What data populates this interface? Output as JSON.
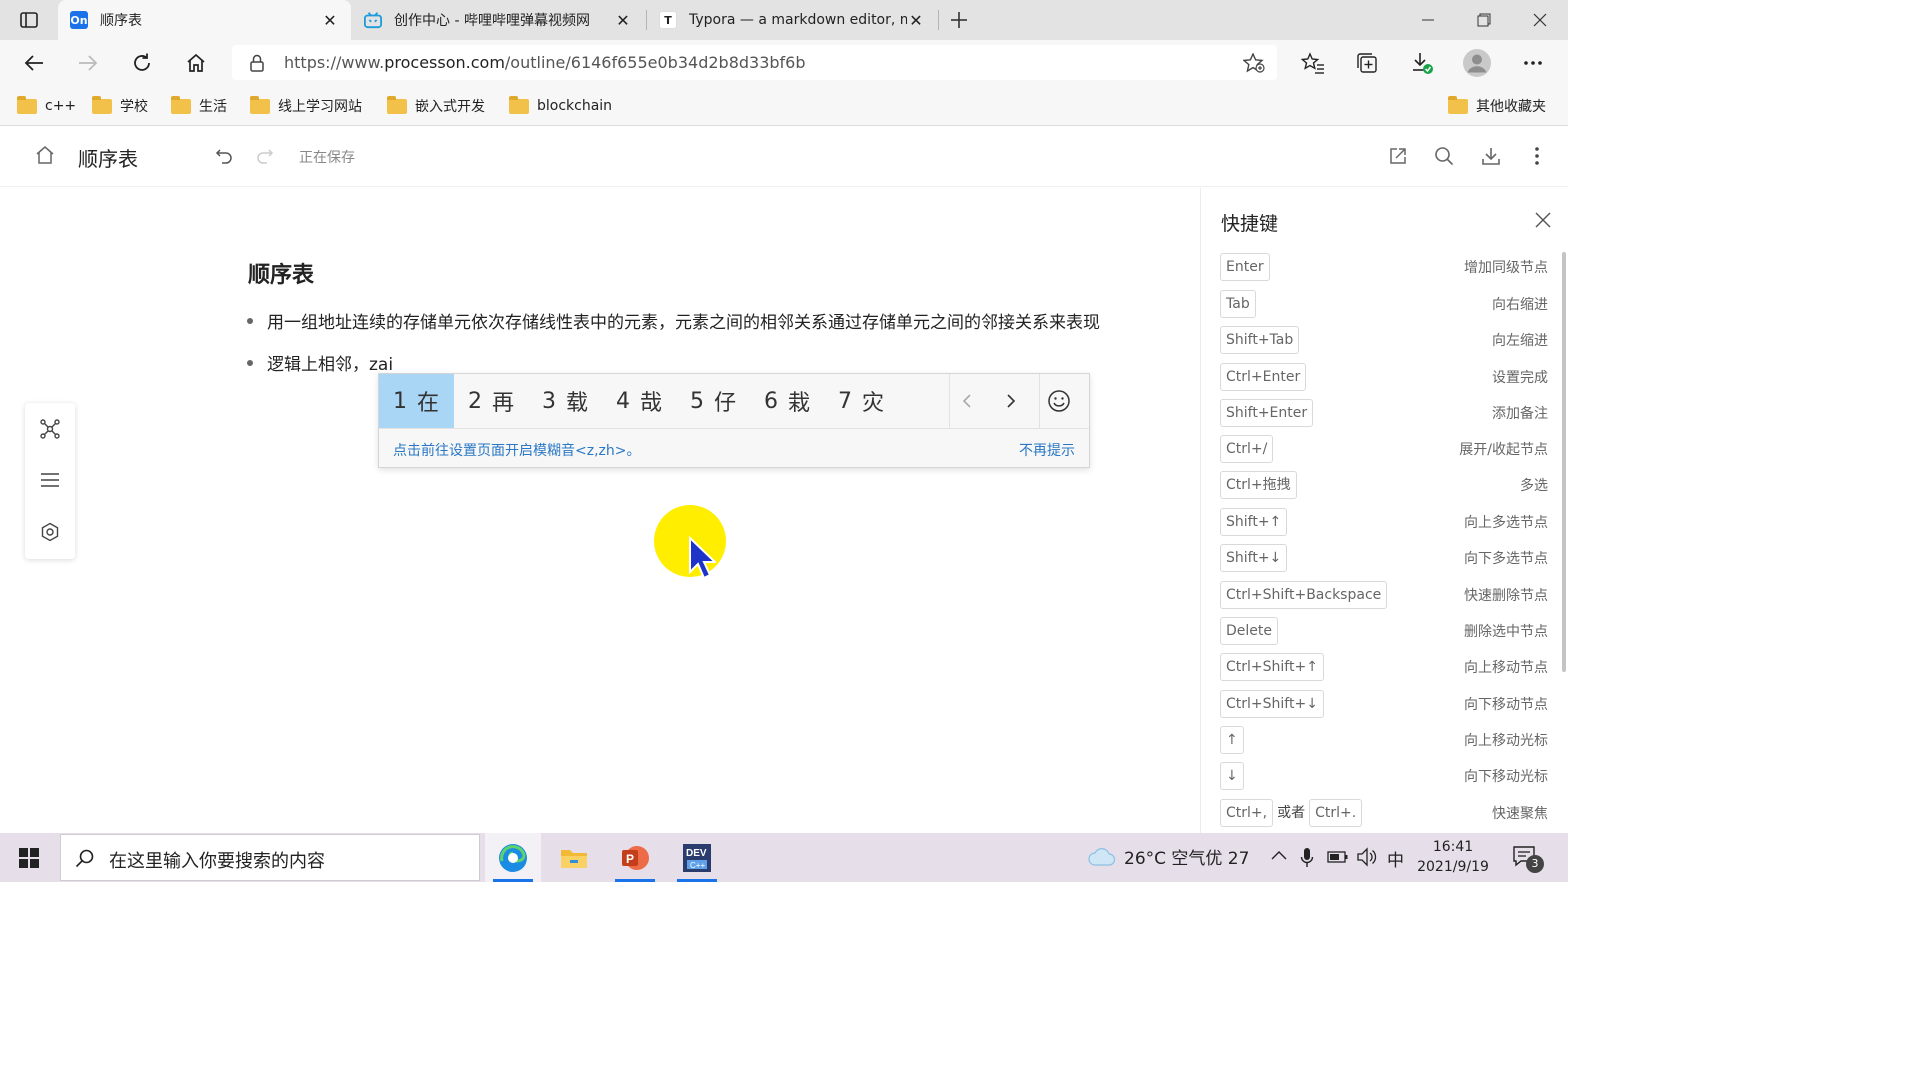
{
  "browser": {
    "tabs": [
      {
        "favicon_text": "On",
        "favicon_color": "#1a73e8",
        "title": "顺序表",
        "active": true
      },
      {
        "favicon_text": "",
        "favicon_color": "#1c9bdb",
        "title": "创作中心 - 哔哩哔哩弹幕视频网",
        "active": false
      },
      {
        "favicon_text": "T",
        "favicon_color": "#ffffff",
        "title": "Typora — a markdown editor, m",
        "active": false
      }
    ],
    "url_prefix": "https://www.",
    "url_host": "processon.com",
    "url_path": "/outline/6146f655e0b34d2b8d33bf6b",
    "bookmarks": [
      "c++",
      "学校",
      "生活",
      "线上学习网站",
      "嵌入式开发",
      "blockchain"
    ],
    "other_bookmarks": "其他收藏夹"
  },
  "app": {
    "title": "顺序表",
    "status": "正在保存"
  },
  "doc": {
    "heading": "顺序表",
    "bullets": [
      "用一组地址连续的存储单元依次存储线性表中的元素，元素之间的相邻关系通过存储单元之间的邻接关系来表现",
      "逻辑上相邻，zai"
    ]
  },
  "ime": {
    "candidates": [
      {
        "num": "1",
        "char": "在"
      },
      {
        "num": "2",
        "char": "再"
      },
      {
        "num": "3",
        "char": "载"
      },
      {
        "num": "4",
        "char": "哉"
      },
      {
        "num": "5",
        "char": "仔"
      },
      {
        "num": "6",
        "char": "栽"
      },
      {
        "num": "7",
        "char": "灾"
      }
    ],
    "tip": "点击前往设置页面开启模糊音<z,zh>。",
    "dismiss": "不再提示"
  },
  "shortcuts": {
    "title": "快捷键",
    "items": [
      {
        "key": "Enter",
        "desc": "增加同级节点"
      },
      {
        "key": "Tab",
        "desc": "向右缩进"
      },
      {
        "key": "Shift+Tab",
        "desc": "向左缩进"
      },
      {
        "key": "Ctrl+Enter",
        "desc": "设置完成"
      },
      {
        "key": "Shift+Enter",
        "desc": "添加备注"
      },
      {
        "key": "Ctrl+/",
        "desc": "展开/收起节点"
      },
      {
        "key": "Ctrl+拖拽",
        "desc": "多选"
      },
      {
        "key": "Shift+↑",
        "desc": "向上多选节点"
      },
      {
        "key": "Shift+↓",
        "desc": "向下多选节点"
      },
      {
        "key": "Ctrl+Shift+Backspace",
        "desc": "快速删除节点"
      },
      {
        "key": "Delete",
        "desc": "删除选中节点"
      },
      {
        "key": "Ctrl+Shift+↑",
        "desc": "向上移动节点"
      },
      {
        "key": "Ctrl+Shift+↓",
        "desc": "向下移动节点"
      },
      {
        "key": "↑",
        "desc": "向上移动光标"
      },
      {
        "key": "↓",
        "desc": "向下移动光标"
      },
      {
        "key": "Ctrl+,",
        "key2": "Ctrl+.",
        "or": "或者",
        "desc": "快速聚焦"
      }
    ]
  },
  "taskbar": {
    "search_placeholder": "在这里输入你要搜索的内容",
    "weather": "26°C 空气优 27",
    "ime_mode": "中",
    "time": "16:41",
    "date": "2021/9/19",
    "notification_count": "3"
  },
  "colors": {
    "ime_selected": "#a9d6f5",
    "link_blue": "#2a78c5",
    "cursor_highlight": "#ffee00"
  }
}
